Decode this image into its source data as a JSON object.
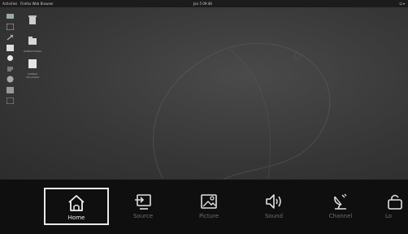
{
  "topbar": {
    "activities": "Activities",
    "app": "Firefox Web Browser",
    "clock": "Jan 5 09:48"
  },
  "desktop_icons": [
    {
      "label": ""
    },
    {
      "label": "Untitled Folder"
    },
    {
      "label": "Untitled Document"
    }
  ],
  "menu": {
    "items": [
      {
        "label": "Home",
        "icon": "home-icon",
        "active": true
      },
      {
        "label": "Source",
        "icon": "source-icon",
        "active": false
      },
      {
        "label": "Picture",
        "icon": "picture-icon",
        "active": false
      },
      {
        "label": "Sound",
        "icon": "sound-icon",
        "active": false
      },
      {
        "label": "Channel",
        "icon": "satellite-dish-icon",
        "active": false
      },
      {
        "label": "Lo",
        "icon": "lock-icon",
        "active": false
      }
    ]
  },
  "colors": {
    "menu_bg": "#0f0f0f",
    "active_border": "#e8e8e8",
    "inactive_label": "#6f6f6f"
  }
}
